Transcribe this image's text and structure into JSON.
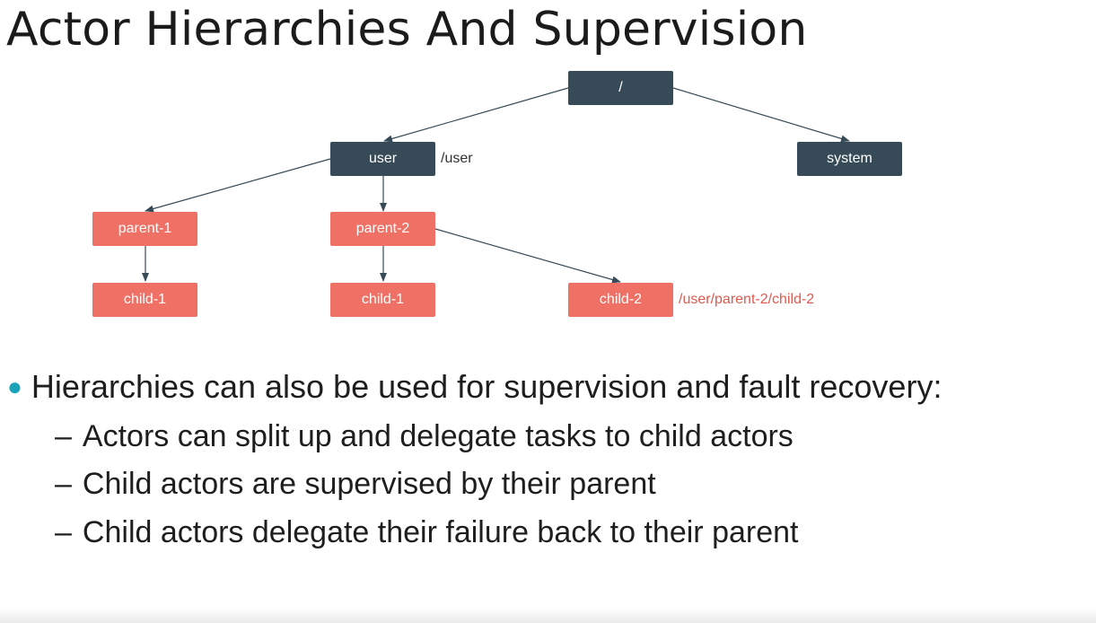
{
  "title": "Actor Hierarchies And Supervision",
  "diagram": {
    "nodes": {
      "root": "/",
      "user": "user",
      "system": "system",
      "parent1": "parent-1",
      "parent2": "parent-2",
      "child1a": "child-1",
      "child1b": "child-1",
      "child2": "child-2"
    },
    "labels": {
      "user_path": "/user",
      "child2_path": "/user/parent-2/child-2"
    },
    "colors": {
      "system_node": "#364b57",
      "user_actor_node": "#ef7165",
      "highlight_path": "#e05a4e",
      "arrow": "#364b57"
    }
  },
  "bullets": {
    "main": "Hierarchies can also be used for supervision and fault recovery:",
    "sub": [
      "Actors can split up and delegate tasks to child actors",
      "Child actors are supervised by their parent",
      "Child actors delegate their failure back to their parent"
    ],
    "dash": "–"
  }
}
